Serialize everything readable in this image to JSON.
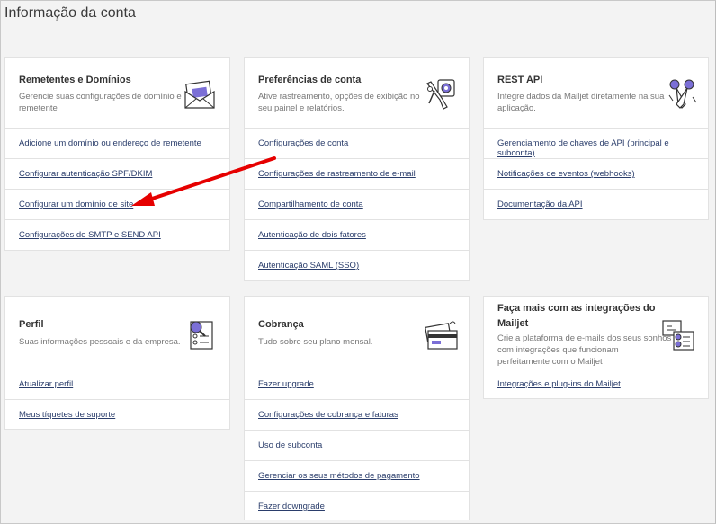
{
  "page_title": "Informação da conta",
  "cards": {
    "remetentes": {
      "title": "Remetentes e Domínios",
      "desc1": "Gerencie suas configurações de domínio e",
      "desc2": "remetente",
      "links": [
        "Adicione um domínio ou endereço de remetente",
        "Configurar autenticação SPF/DKIM",
        "Configurar um domínio de site",
        "Configurações de SMTP e SEND API"
      ]
    },
    "preferencias": {
      "title": "Preferências de conta",
      "desc1": "Ative rastreamento, opções de exibição no",
      "desc2": "seu painel e relatórios.",
      "links": [
        "Configurações de conta",
        "Configurações de rastreamento de e-mail",
        "Compartilhamento de conta",
        "Autenticação de dois fatores",
        "Autenticação SAML (SSO)"
      ]
    },
    "rest": {
      "title": "REST API",
      "desc1": "Integre dados da Mailjet diretamente na sua",
      "desc2": "aplicação.",
      "links": [
        "Gerenciamento de chaves de API (principal e subconta)",
        "Notificações de eventos (webhooks)",
        "Documentação da API"
      ]
    },
    "perfil": {
      "title": "Perfil",
      "desc1": "Suas informações pessoais e da empresa.",
      "links": [
        "Atualizar perfil",
        "Meus tíquetes de suporte"
      ]
    },
    "cobranca": {
      "title": "Cobrança",
      "desc1": "Tudo sobre seu plano mensal.",
      "links": [
        "Fazer upgrade",
        "Configurações de cobrança e faturas",
        "Uso de subconta",
        "Gerenciar os seus métodos de pagamento",
        "Fazer downgrade"
      ]
    },
    "integracoes": {
      "title1": "Faça mais com as integrações do",
      "title2": "Mailjet",
      "desc1": "Crie a plataforma de e-mails dos seus sonhos",
      "desc2": "com integrações que funcionam",
      "desc3": "perfeitamente com o Mailjet",
      "links": [
        "Integrações e plug-ins do Mailjet"
      ]
    }
  },
  "colors": {
    "accent_purple": "#7b6fd6",
    "arrow_red": "#e60000",
    "link": "#2a3d6b"
  }
}
